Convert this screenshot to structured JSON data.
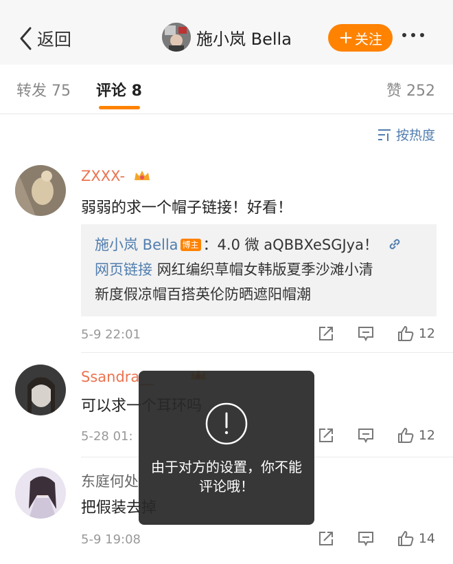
{
  "topbar": {
    "back_label": "返回",
    "profile_name": "施小岚 Bella",
    "follow_label": "关注",
    "follow_plus": "+",
    "accent": "#ff8200"
  },
  "tabs": {
    "repost": "转发 75",
    "comment": "评论 8",
    "like": "赞 252"
  },
  "sort": {
    "label": "按热度"
  },
  "comments": [
    {
      "name": "ZXXX-",
      "text": "弱弱的求一个帽子链接！好看！",
      "quote": {
        "author": "施小岚 Bella",
        "badge": "博主",
        "line1_rest": "：4.0 微 aQBBXeSGJya！",
        "link_label": "网页链接",
        "line2_rest": "网红编织草帽女韩版夏季沙滩小清",
        "line3": "新度假凉帽百搭英伦防晒遮阳帽潮"
      },
      "time": "5-9 22:01",
      "likes": "12"
    },
    {
      "name": "Ssandra__",
      "text": "可以求一个耳环吗",
      "time": "5-28 01:",
      "likes": "12"
    },
    {
      "name": "东庭何处",
      "text": "把假装去掉",
      "time": "5-9 19:08",
      "likes": "14"
    }
  ],
  "toast": {
    "message": "由于对方的设置，你不能评论哦！"
  }
}
